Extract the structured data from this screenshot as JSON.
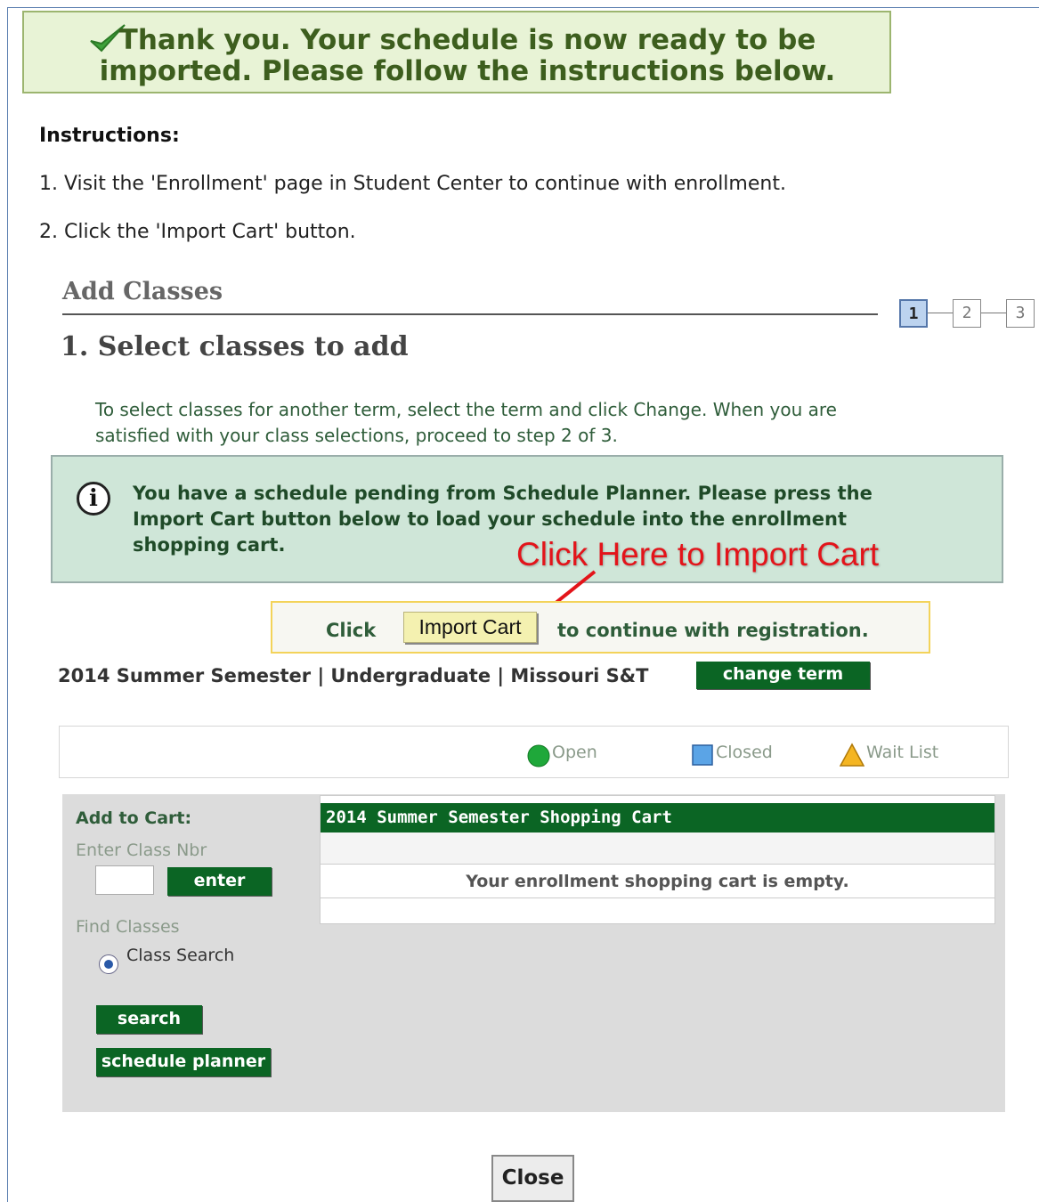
{
  "banner": {
    "message_line1": "Thank you. Your schedule is now ready to be",
    "message_line2": "imported. Please follow the instructions below.",
    "icon": "check-icon",
    "color": "#3d5e1e"
  },
  "instructions": {
    "heading": "Instructions:",
    "step1": "1. Visit the 'Enrollment' page in Student Center to continue with enrollment.",
    "step2": "2. Click the 'Import Cart' button."
  },
  "add_classes": {
    "title": "Add Classes",
    "steps": [
      "1",
      "2",
      "3"
    ],
    "active_step": 1,
    "subtitle": "1.  Select classes to add",
    "description_line1": "To select classes for another term, select the term and click Change.  When you are",
    "description_line2": "satisfied with your class selections, proceed to step 2 of 3."
  },
  "info_box": {
    "icon": "info-icon",
    "line1": "You have a schedule pending from Schedule Planner.  Please press the",
    "line2": "Import Cart button below to load your schedule into the enrollment",
    "line3": "shopping cart."
  },
  "annotation": {
    "callout": "Click Here to Import Cart",
    "color": "#e3141a"
  },
  "import_bar": {
    "click_word": "Click",
    "import_button": "Import Cart",
    "continue_text": "to continue with registration."
  },
  "term": {
    "label": "2014 Summer Semester | Undergraduate | Missouri S&T",
    "change_button": "change term"
  },
  "legend": {
    "open": "Open",
    "closed": "Closed",
    "wait_list": "Wait List"
  },
  "add_to_cart": {
    "heading": "Add to Cart:",
    "enter_label": "Enter Class Nbr",
    "class_nbr_value": "",
    "enter_button": "enter",
    "find_label": "Find Classes",
    "class_search_label": "Class Search",
    "search_button": "search",
    "planner_button": "schedule planner"
  },
  "cart": {
    "header": "2014 Summer Semester Shopping Cart",
    "empty_message": "Your enrollment shopping cart is empty."
  },
  "footer": {
    "close_button": "Close"
  },
  "colors": {
    "button_green": "#0b6524",
    "info_bg": "#cfe6d8",
    "success_bg": "#e8f3d6"
  }
}
